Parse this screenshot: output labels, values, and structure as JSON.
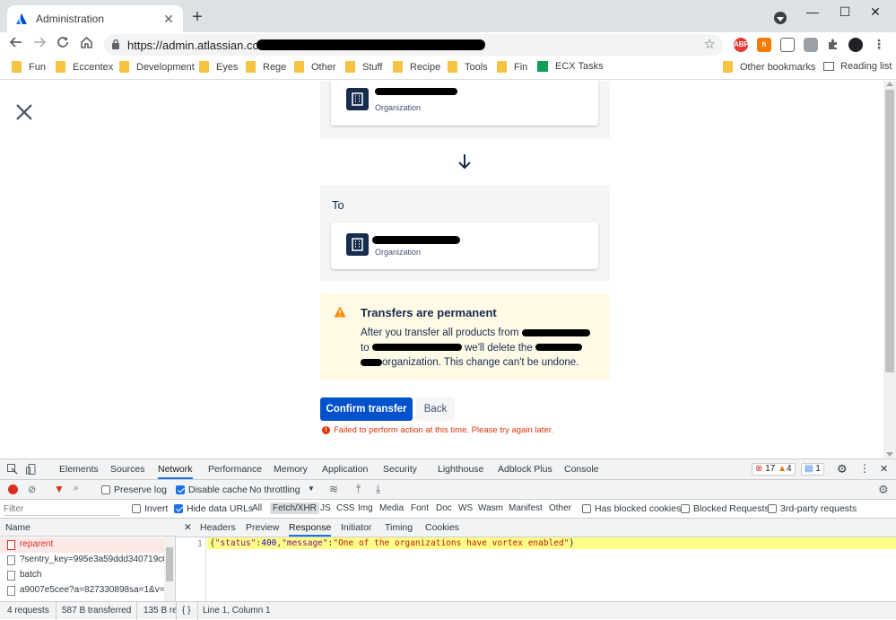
{
  "tab": {
    "title": "Administration",
    "close": "✕",
    "new_tab": "+"
  },
  "window": {
    "minimize": "—",
    "maximize": "☐",
    "close": "✕"
  },
  "address": {
    "url_host": "https://admin.atlassian.com/o"
  },
  "bookmarks": [
    {
      "label": "Fun"
    },
    {
      "label": "Eccentex"
    },
    {
      "label": "Development"
    },
    {
      "label": "Eyes"
    },
    {
      "label": "Rege"
    },
    {
      "label": "Other"
    },
    {
      "label": "Stuff"
    },
    {
      "label": "Recipe"
    },
    {
      "label": "Tools"
    },
    {
      "label": "Fin"
    },
    {
      "label": "ECX Tasks"
    }
  ],
  "bookmarks_right": {
    "other": "Other bookmarks",
    "reading": "Reading list"
  },
  "page": {
    "from_org": {
      "subtitle": "Organization"
    },
    "to": {
      "label": "To",
      "subtitle": "Organization"
    },
    "warning": {
      "title": "Transfers are permanent",
      "p1": "After you transfer all products from",
      "p2": "to",
      "p3": "we'll delete the",
      "p4": "organization. This change can't be undone."
    },
    "confirm_button": "Confirm transfer",
    "back_button": "Back",
    "error": "Failed to perform action at this time. Please try again later.",
    "error_icon": "!"
  },
  "devtools": {
    "tabs": [
      "Elements",
      "Sources",
      "Network",
      "Performance",
      "Memory",
      "Application",
      "Security",
      "Lighthouse",
      "Adblock Plus",
      "Console"
    ],
    "active_tab": "Network",
    "errors": "17",
    "warnings": "4",
    "messages": "1",
    "toolbar": {
      "preserve_log": "Preserve log",
      "disable_cache": "Disable cache",
      "throttling": "No throttling"
    },
    "filter": {
      "placeholder": "Filter",
      "invert": "Invert",
      "hide_data_urls": "Hide data URLs",
      "types": [
        "All",
        "Fetch/XHR",
        "JS",
        "CSS",
        "Img",
        "Media",
        "Font",
        "Doc",
        "WS",
        "Wasm",
        "Manifest",
        "Other"
      ],
      "active_type": "Fetch/XHR",
      "has_blocked_cookies": "Has blocked cookies",
      "blocked_requests": "Blocked Requests",
      "third_party": "3rd-party requests"
    },
    "requests": {
      "header": "Name",
      "rows": [
        {
          "name": "reparent",
          "error": true
        },
        {
          "name": "?sentry_key=995e3a59ddd340719c07",
          "error": false
        },
        {
          "name": "batch",
          "error": false
        },
        {
          "name": "a9007e5cee?a=827330898sa=1&v=1",
          "error": false
        }
      ]
    },
    "detail_tabs": [
      "Headers",
      "Preview",
      "Response",
      "Initiator",
      "Timing",
      "Cookies"
    ],
    "active_detail": "Response",
    "close_detail": "✕",
    "response": {
      "line_number": "1",
      "key_status": "\"status\"",
      "val_status": "400",
      "key_message": "\"message\"",
      "val_message": "\"One of the organizations have vortex enabled\""
    },
    "status": {
      "requests": "4 requests",
      "transferred": "587 B transferred",
      "resources": "135 B re",
      "braces": "{ }",
      "cursor": "Line 1, Column 1"
    }
  },
  "colors": {
    "primary": "#0052cc",
    "error": "#de350b",
    "warning_bg": "#fffae6",
    "warning_icon": "#ff8b00",
    "devtools_accent": "#1a73e8"
  }
}
